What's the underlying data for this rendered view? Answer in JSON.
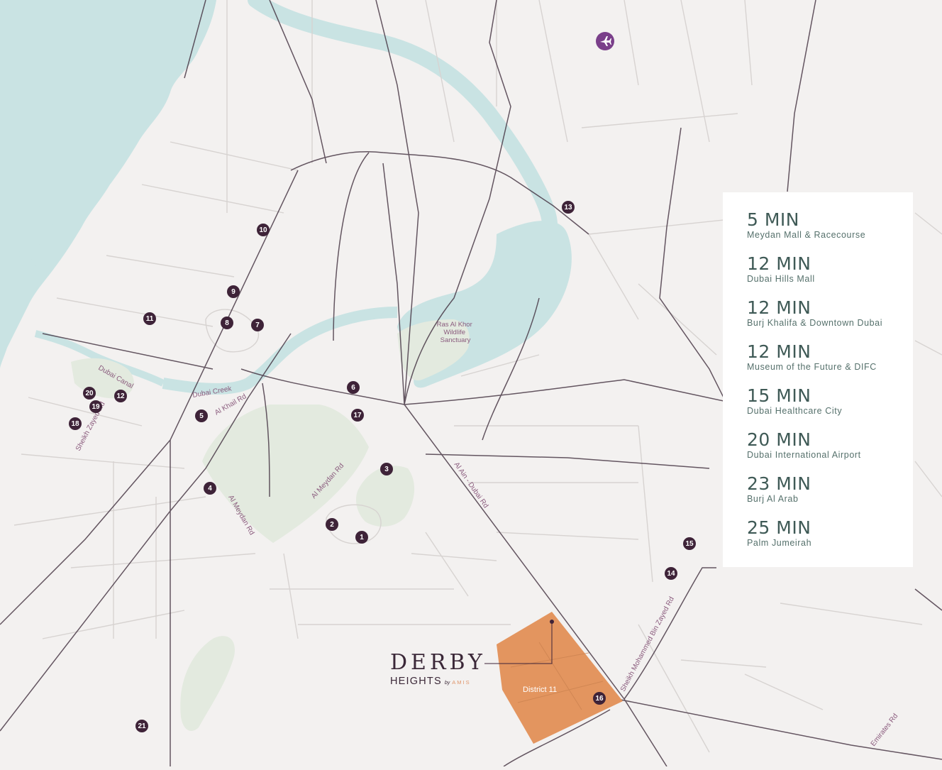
{
  "colors": {
    "background": "#f3f1f0",
    "water": "#c9e3e3",
    "park": "#e3eadf",
    "road_major": "#4a3a48",
    "road_minor": "#d7d3d1",
    "marker": "#3e2338",
    "district": "#e3955f",
    "panel_text": "#3f5a56"
  },
  "icons": {
    "airport": "airplane-icon"
  },
  "district_label": "District 11",
  "area_labels": {
    "ras_al_khor": [
      "Ras Al Khor",
      "Wildlife",
      "Sanctuary"
    ]
  },
  "road_labels": {
    "dubai_canal": "Dubai Canal",
    "dubai_creek": "Dubai Creek",
    "al_khail": "Al Khail Rd",
    "sheikh_zayed": "Sheikh Zayed Rd",
    "al_meydan_1": "Al Meydan Rd",
    "al_meydan_2": "Al Meydan Rd",
    "al_ain": "Al Ain - Dubai Rd",
    "smbz": "Sheikh Mohammed Bin Zayed Rd",
    "emirates": "Emirates Rd"
  },
  "markers": [
    "1",
    "2",
    "3",
    "4",
    "5",
    "6",
    "7",
    "8",
    "9",
    "10",
    "11",
    "12",
    "13",
    "14",
    "15",
    "16",
    "17",
    "18",
    "19",
    "20",
    "21"
  ],
  "logo": {
    "main": "DERBY",
    "sub": "HEIGHTS",
    "by": "by",
    "brand": "AMIS"
  },
  "travel_times": [
    {
      "time": "5 MIN",
      "destination": "Meydan Mall & Racecourse"
    },
    {
      "time": "12 MIN",
      "destination": "Dubai Hills Mall"
    },
    {
      "time": "12 MIN",
      "destination": "Burj Khalifa & Downtown Dubai"
    },
    {
      "time": "12 MIN",
      "destination": "Museum of the Future & DIFC"
    },
    {
      "time": "15 MIN",
      "destination": "Dubai Healthcare City"
    },
    {
      "time": "20 MIN",
      "destination": "Dubai International Airport"
    },
    {
      "time": "23 MIN",
      "destination": "Burj Al Arab"
    },
    {
      "time": "25 MIN",
      "destination": "Palm Jumeirah"
    }
  ]
}
